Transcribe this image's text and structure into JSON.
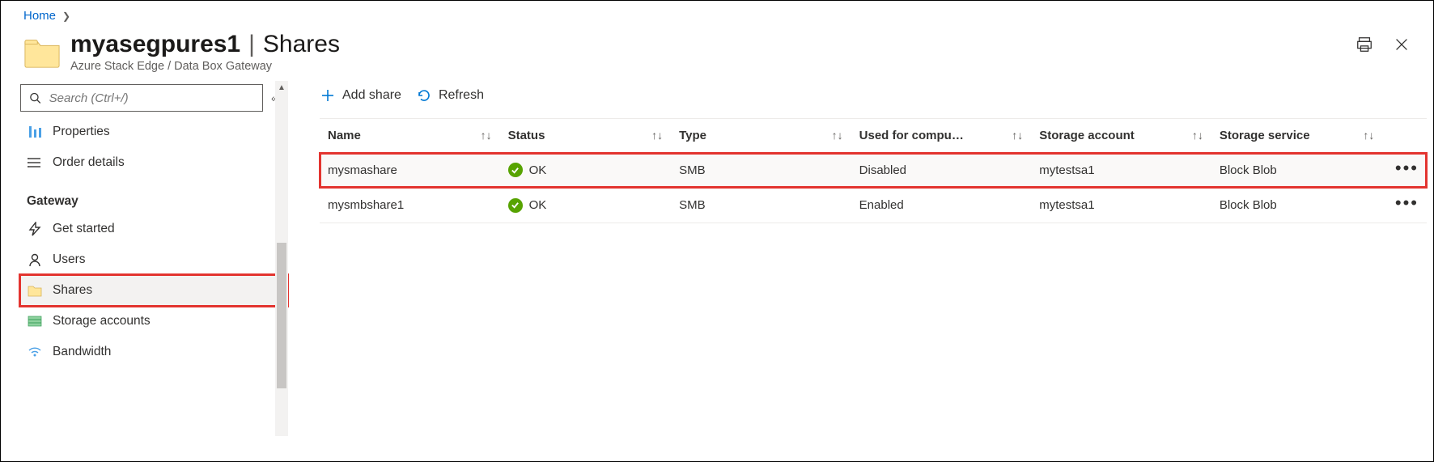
{
  "breadcrumb": {
    "home": "Home"
  },
  "header": {
    "resource_name": "myasegpures1",
    "section": "Shares",
    "subtitle": "Azure Stack Edge / Data Box Gateway"
  },
  "search": {
    "placeholder": "Search (Ctrl+/)"
  },
  "nav": {
    "properties": "Properties",
    "order_details": "Order details",
    "section_gateway": "Gateway",
    "get_started": "Get started",
    "users": "Users",
    "shares": "Shares",
    "storage_accounts": "Storage accounts",
    "bandwidth": "Bandwidth"
  },
  "toolbar": {
    "add_share": "Add share",
    "refresh": "Refresh"
  },
  "table": {
    "columns": {
      "name": "Name",
      "status": "Status",
      "type": "Type",
      "used_compute": "Used for compu…",
      "storage_account": "Storage account",
      "storage_service": "Storage service"
    },
    "rows": [
      {
        "name": "mysmashare",
        "status": "OK",
        "type": "SMB",
        "used_compute": "Disabled",
        "storage_account": "mytestsa1",
        "storage_service": "Block Blob"
      },
      {
        "name": "mysmbshare1",
        "status": "OK",
        "type": "SMB",
        "used_compute": "Enabled",
        "storage_account": "mytestsa1",
        "storage_service": "Block Blob"
      }
    ]
  }
}
